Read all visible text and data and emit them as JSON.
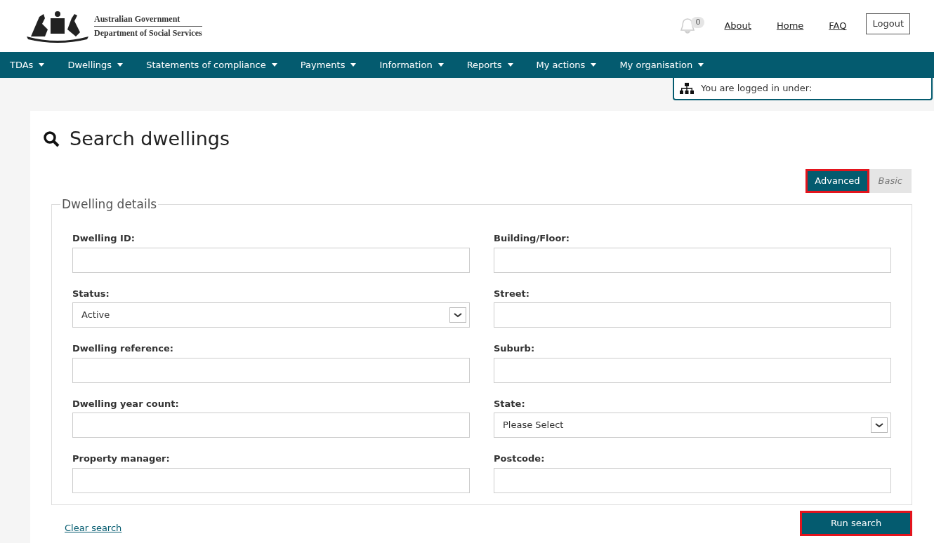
{
  "header": {
    "logo_line_1": "Australian Government",
    "logo_line_2": "Department of Social Services",
    "notifications": "0",
    "links": [
      "About",
      "Home",
      "FAQ"
    ],
    "logout": "Logout"
  },
  "nav": [
    "TDAs",
    "Dwellings",
    "Statements of compliance",
    "Payments",
    "Information",
    "Reports",
    "My actions",
    "My organisation"
  ],
  "org_popup": "You are logged in under:",
  "page_title": "Search dwellings",
  "mode_tabs": [
    {
      "label": "Advanced",
      "selected": true,
      "highlighted": true
    },
    {
      "label": "Basic",
      "selected": false,
      "highlighted": false
    }
  ],
  "fieldset": {
    "legend": "Dwelling details",
    "left": [
      {
        "label": "Dwelling ID:",
        "kind": "text"
      },
      {
        "label": "Status:",
        "kind": "select",
        "value": "Active"
      },
      {
        "label": "Dwelling reference:",
        "kind": "text"
      },
      {
        "label": "Dwelling year count:",
        "kind": "text"
      },
      {
        "label": "Property manager:",
        "kind": "text"
      }
    ],
    "right": [
      {
        "label": "Building/Floor:",
        "kind": "text"
      },
      {
        "label": "Street:",
        "kind": "text"
      },
      {
        "label": "Suburb:",
        "kind": "text"
      },
      {
        "label": "State:",
        "kind": "select",
        "value": "Please Select"
      },
      {
        "label": "Postcode:",
        "kind": "text"
      }
    ]
  },
  "clear_link": "Clear search",
  "run_button": {
    "label": "Run search",
    "highlighted": true
  }
}
